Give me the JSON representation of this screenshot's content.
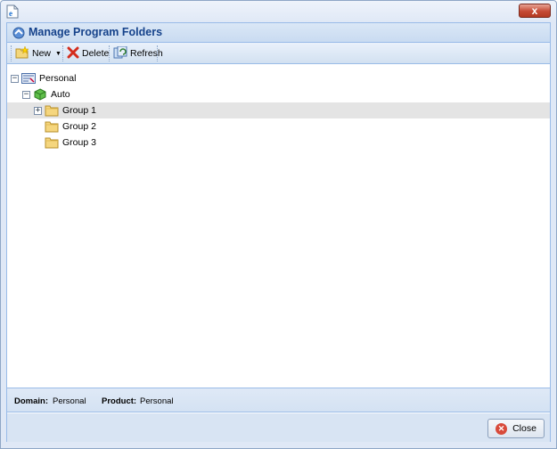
{
  "window": {
    "close_glyph": "x"
  },
  "panel": {
    "title": "Manage Program Folders"
  },
  "toolbar": {
    "new_label": "New",
    "delete_label": "Delete",
    "refresh_label": "Refresh"
  },
  "tree": {
    "root": {
      "label": "Personal",
      "icon": "personal-folder-icon",
      "expanded": true
    },
    "child": {
      "label": "Auto",
      "icon": "green-cube-icon",
      "expanded": true
    },
    "groups": [
      {
        "label": "Group 1",
        "icon": "folder-icon",
        "has_children": true,
        "selected": true
      },
      {
        "label": "Group 2",
        "icon": "folder-icon",
        "has_children": false,
        "selected": false
      },
      {
        "label": "Group 3",
        "icon": "folder-icon",
        "has_children": false,
        "selected": false
      }
    ]
  },
  "status": {
    "domain_label": "Domain:",
    "domain_value": "Personal",
    "product_label": "Product:",
    "product_value": "Personal"
  },
  "footer": {
    "close_label": "Close"
  },
  "colors": {
    "accent": "#15428b",
    "border": "#99bbe8",
    "selected_row": "#e4e4e4",
    "close_red": "#d84a3a"
  }
}
